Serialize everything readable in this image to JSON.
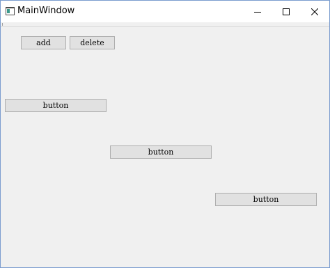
{
  "window": {
    "title": "MainWindow",
    "icon": "qt-app-icon",
    "controls": {
      "minimize": "minimize-icon",
      "maximize": "maximize-icon",
      "close": "close-icon"
    }
  },
  "buttons": {
    "add_label": "add",
    "delete_label": "delete",
    "button1_label": "button",
    "button2_label": "button",
    "button3_label": "button"
  },
  "colors": {
    "window_background": "#f0f0f0",
    "titlebar_background": "#ffffff",
    "button_face": "#e1e1e1",
    "button_border": "#adadad",
    "window_border": "#7a9ccf"
  }
}
